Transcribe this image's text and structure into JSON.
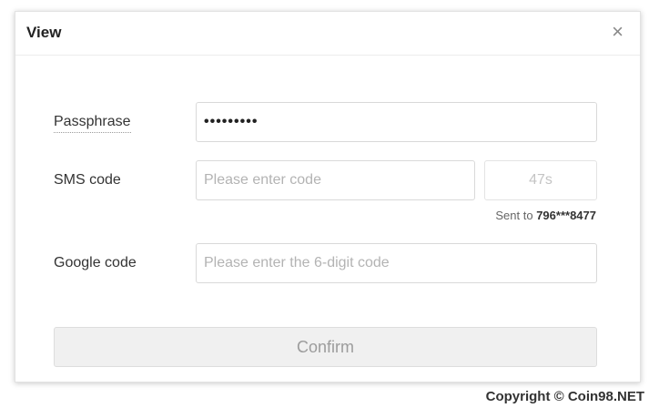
{
  "dialog": {
    "title": "View",
    "close_icon": "×"
  },
  "form": {
    "passphrase": {
      "label": "Passphrase",
      "value": "•••••••••"
    },
    "sms": {
      "label": "SMS code",
      "placeholder": "Please enter code",
      "countdown": "47s",
      "sent_prefix": "Sent to",
      "phone": "796***8477"
    },
    "google": {
      "label": "Google code",
      "placeholder": "Please enter the 6-digit code"
    },
    "confirm_label": "Confirm"
  },
  "watermark": {
    "text": "Copyright © Coin98.NET"
  }
}
